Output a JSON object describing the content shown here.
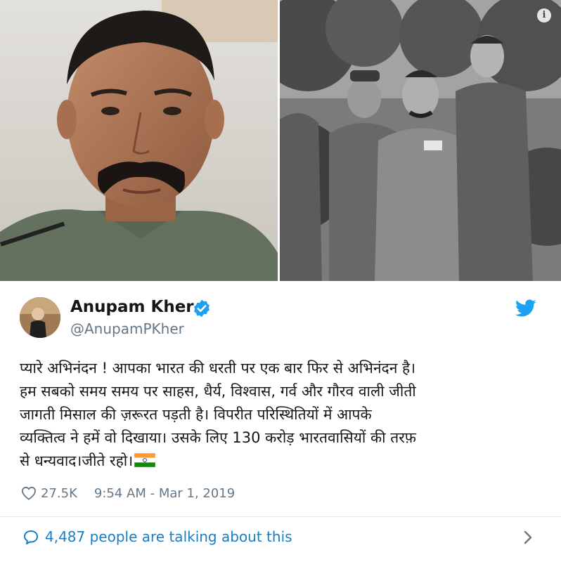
{
  "tweet": {
    "author_name": "Anupam Kher",
    "handle": "@AnupamPKher",
    "text": "प्यारे अभिनंदन ! आपका भारत की धरती पर एक बार फिर से अभिनंदन है।\nहम सबको समय समय पर साहस, धैर्य, विश्वास, गर्व और गौरव वाली जीती\nजागती मिसाल की ज़रूरत पड़ती है। विपरीत परिस्थितियों में आपके\nव्यक्तित्व ने हमें वो दिखाया। उसके लिए 130 करोड़ भारतवासियों की तरफ़\nसे धन्यवाद।जीते रहो।",
    "emoji": "indian-flag",
    "likes": "27.5K",
    "timestamp": "9:54 AM - Mar 1, 2019",
    "talking_about": "4,487 people are talking about this"
  },
  "icons": {
    "verified": "verified-badge-icon",
    "platform": "twitter-bird-icon",
    "like": "heart-icon",
    "comment": "comment-icon",
    "more": "chevron-right-icon",
    "info": "info-icon"
  },
  "colors": {
    "accent": "#1da1f2",
    "link": "#1b7dc4",
    "secondary_text": "#657786",
    "divider": "#e1e8ed"
  }
}
